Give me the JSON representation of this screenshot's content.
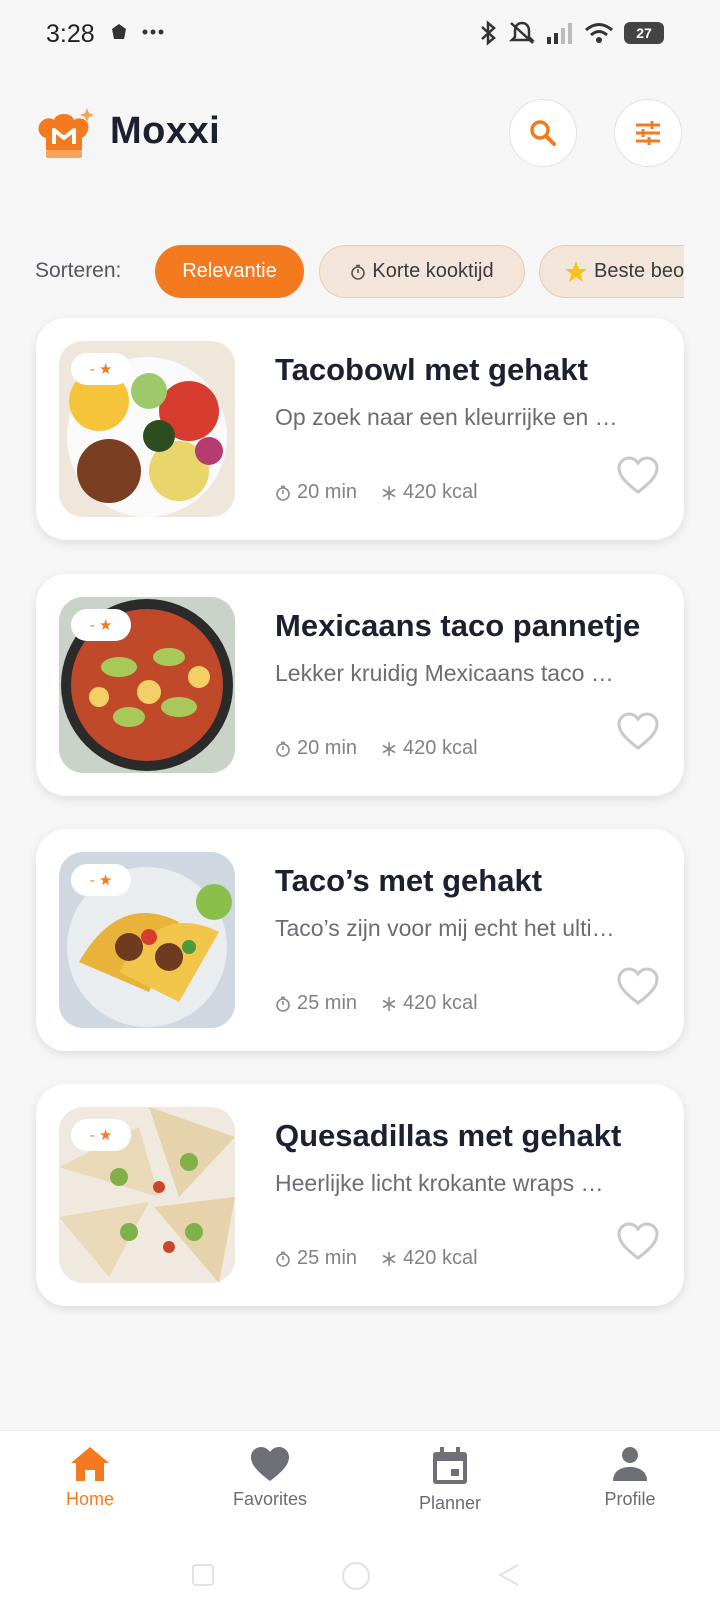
{
  "status_bar": {
    "time": "3:28",
    "battery": "27"
  },
  "header": {
    "app_name": "Moxxi"
  },
  "sort": {
    "label": "Sorteren:",
    "options": [
      "Relevantie",
      "Korte kooktijd",
      "Beste beo"
    ]
  },
  "recipes": [
    {
      "badge": "- ★",
      "title": "Tacobowl met gehakt",
      "description": "Op zoek naar een kleurrijke en …",
      "time": "20 min",
      "calories": "420 kcal"
    },
    {
      "badge": "- ★",
      "title": "Mexicaans taco pannetje",
      "description": "Lekker kruidig Mexicaans taco …",
      "time": "20 min",
      "calories": "420 kcal"
    },
    {
      "badge": "- ★",
      "title": "Taco’s met gehakt",
      "description": "Taco’s zijn voor mij echt het ulti…",
      "time": "25 min",
      "calories": "420 kcal"
    },
    {
      "badge": "- ★",
      "title": "Quesadillas met gehakt",
      "description": "Heerlijke licht krokante wraps …",
      "time": "25 min",
      "calories": "420 kcal"
    }
  ],
  "bottom_nav": [
    {
      "label": "Home",
      "icon": "home-icon",
      "active": true
    },
    {
      "label": "Favorites",
      "icon": "heart-icon",
      "active": false
    },
    {
      "label": "Planner",
      "icon": "calendar-icon",
      "active": false
    },
    {
      "label": "Profile",
      "icon": "person-icon",
      "active": false
    }
  ],
  "colors": {
    "accent": "#f47a20",
    "chip_bg": "#f4e5da",
    "text_dark": "#1c2030"
  }
}
